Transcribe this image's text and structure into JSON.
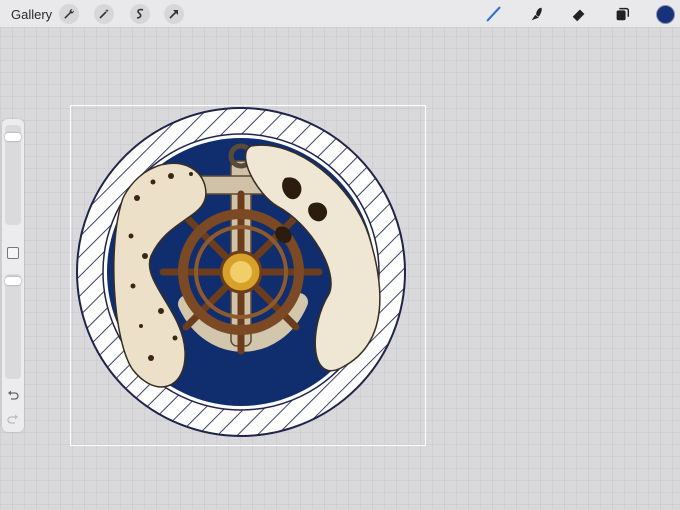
{
  "topbar": {
    "gallery_label": "Gallery",
    "left_tools": [
      "wrench-icon",
      "magic-wand-icon",
      "selection-icon",
      "transform-arrow-icon"
    ],
    "right_tools": [
      "brush-icon",
      "smudge-icon",
      "eraser-icon",
      "layers-icon"
    ],
    "active_color": "#17327a",
    "active_tool_color": "#2f6fd6"
  },
  "sidebar": {
    "brush_size": 0.92,
    "brush_opacity": 0.98,
    "icons": [
      "modify-button",
      "undo-icon",
      "redo-icon"
    ]
  },
  "canvas": {
    "artwork": "illustration-emblem"
  }
}
